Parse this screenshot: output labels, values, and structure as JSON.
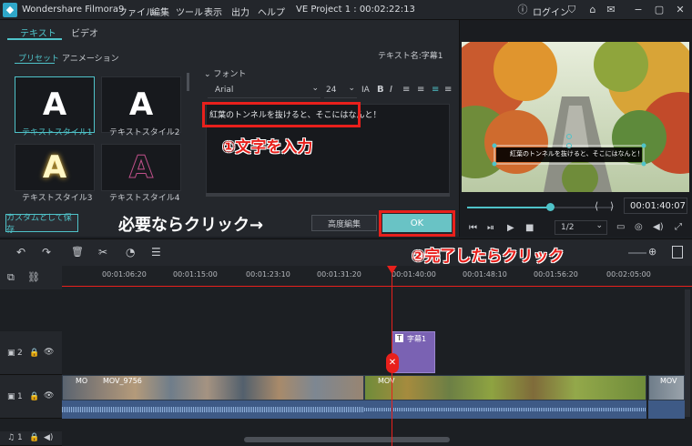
{
  "titlebar": {
    "app": "Wondershare Filmora9",
    "menu": [
      "ファイル",
      "編集",
      "ツール",
      "表示",
      "出力",
      "ヘルプ"
    ],
    "project": "VE Project 1 : 00:02:22:13",
    "login": "ログイン"
  },
  "editor": {
    "tabs": [
      "テキスト",
      "ビデオ"
    ],
    "subtabs": [
      "プリセット",
      "アニメーション"
    ],
    "text_name": "テキスト名:字幕1",
    "font_section": "フォント",
    "font": "Arial",
    "size": "24",
    "text_content": "紅葉のトンネルを抜けると、そこにはなんと！",
    "presets": [
      {
        "glyph": "A",
        "label": "テキストスタイル1"
      },
      {
        "glyph": "A",
        "label": "テキストスタイル2"
      },
      {
        "glyph": "A",
        "label": "テキストスタイル3"
      },
      {
        "glyph": "A",
        "label": "テキストスタイル4"
      }
    ],
    "save_custom": "カスタムとして保存",
    "advanced": "高度編集",
    "ok": "OK"
  },
  "annotations": {
    "step1": "①文字を入力",
    "click_if_needed": "必要ならクリック→",
    "step2": "②完了したらクリック"
  },
  "preview": {
    "caption": "紅葉のトンネルを抜けると、そこにはなんと！",
    "time": "00:01:40:07",
    "ratio": "1/2"
  },
  "timeline": {
    "ticks": [
      "00:01:06:20",
      "00:01:15:00",
      "00:01:23:10",
      "00:01:31:20",
      "00:01:40:00",
      "00:01:48:10",
      "00:01:56:20",
      "00:02:05:00"
    ],
    "tracks": [
      "2",
      "1",
      "1"
    ],
    "subtitle_clip": "字幕1",
    "video_clip_labels": [
      "MO",
      "MOV_9756",
      "MOV",
      "MOV"
    ]
  },
  "colors": {
    "accent": "#4fc3c9",
    "annotation_red": "#e8201c",
    "clip_purple": "#7a62b3"
  }
}
